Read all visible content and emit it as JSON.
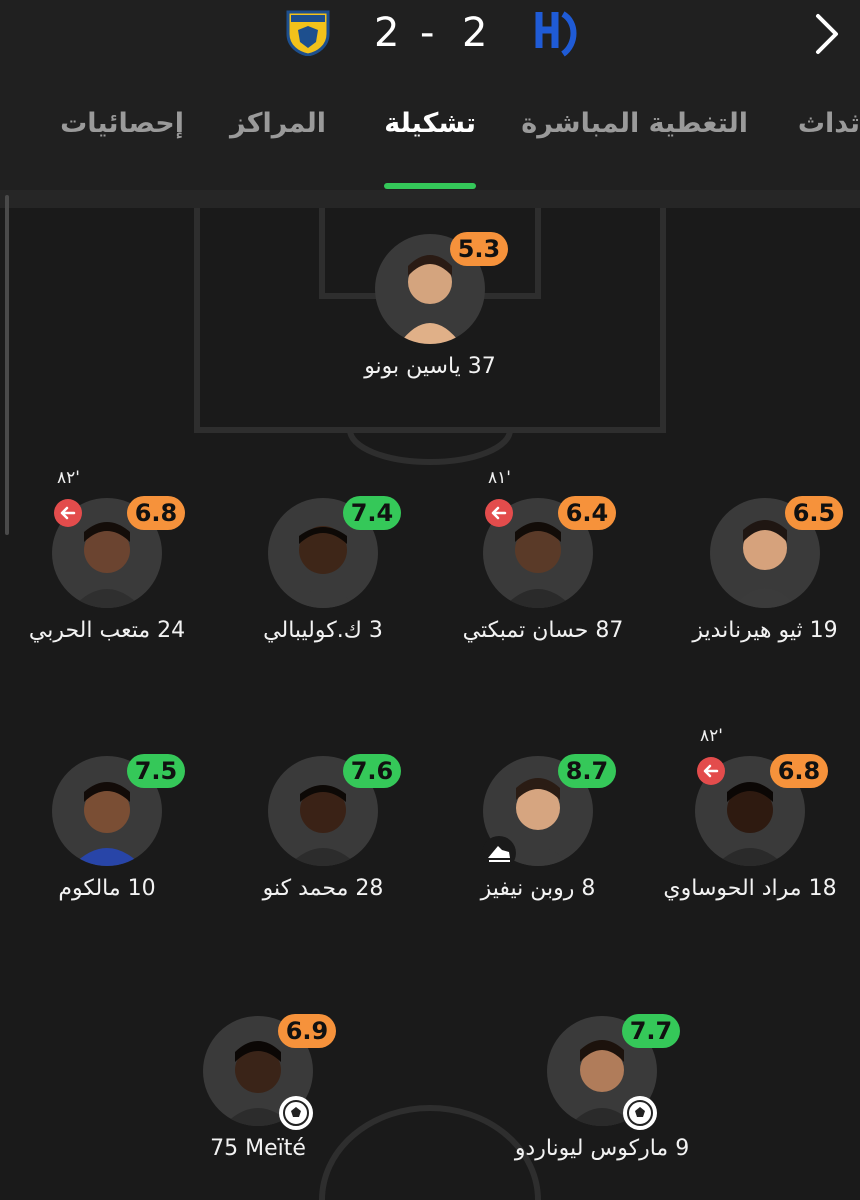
{
  "match": {
    "score_home": "2",
    "score_sep": "-",
    "score_away": "2",
    "home_logo_icon": "al-taawoun-crest-icon",
    "away_logo_icon": "al-hilal-crest-icon"
  },
  "tabs": [
    "ثداث",
    "التغطية المباشرة",
    "تشكيلة",
    "المراكز",
    "إحصائيات"
  ],
  "active_tab": "تشكيلة",
  "colors": {
    "rating_high": "#35c859",
    "rating_mid": "#f6923b",
    "sub_out": "#e34c4c",
    "tab_indicator": "#34c759"
  },
  "players": [
    {
      "name": "37 ياسين بونو",
      "rating": "5.3",
      "rating_color": "orange"
    },
    {
      "name": "19 ثيو هيرنانديز",
      "rating": "6.5",
      "rating_color": "orange"
    },
    {
      "name": "87 حسان تمبكتي",
      "rating": "6.4",
      "rating_color": "orange",
      "sub_time": "٨١'"
    },
    {
      "name": "3 ك.كوليبالي",
      "rating": "7.4",
      "rating_color": "green"
    },
    {
      "name": "24 متعب الحربي",
      "rating": "6.8",
      "rating_color": "orange",
      "sub_time": "٨٢'"
    },
    {
      "name": "18 مراد الحوساوي",
      "rating": "6.8",
      "rating_color": "orange",
      "sub_time": "٨٢'"
    },
    {
      "name": "8 روبن نيفيز",
      "rating": "8.7",
      "rating_color": "green",
      "badge": "boot-icon"
    },
    {
      "name": "28 محمد كنو",
      "rating": "7.6",
      "rating_color": "green"
    },
    {
      "name": "10 مالكوم",
      "rating": "7.5",
      "rating_color": "green"
    },
    {
      "name": "9 ماركوس ليوناردو",
      "rating": "7.7",
      "rating_color": "green",
      "badge": "ball-icon"
    },
    {
      "name": "75 Meïté",
      "rating": "6.9",
      "rating_color": "orange",
      "badge": "ball-icon"
    }
  ]
}
